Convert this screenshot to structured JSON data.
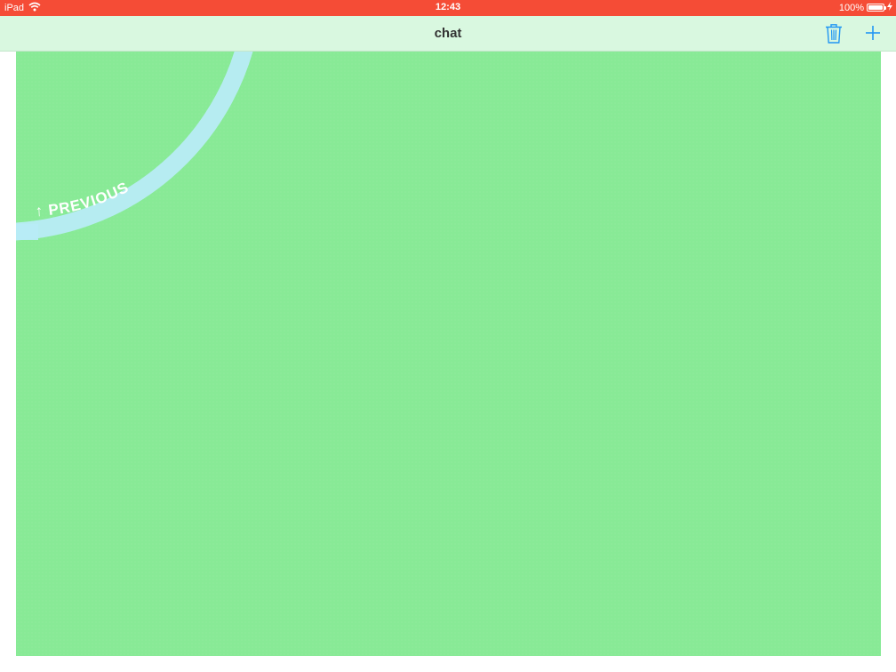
{
  "status_bar": {
    "device": "iPad",
    "time": "12:43",
    "battery_percent": "100%",
    "wifi_icon": "wifi-icon",
    "battery_icon": "battery-icon",
    "charging_icon": "bolt-icon"
  },
  "nav_bar": {
    "title": "chat",
    "trash_icon": "trash-icon",
    "add_icon": "plus-icon"
  },
  "content": {
    "previous_label": "↑ PREVIOUS"
  },
  "colors": {
    "status_bar": "#f54c36",
    "nav_bar": "#d9f8e0",
    "content_background": "#88ea96",
    "arc": "#b8ecf6",
    "accent": "#2196f3"
  }
}
